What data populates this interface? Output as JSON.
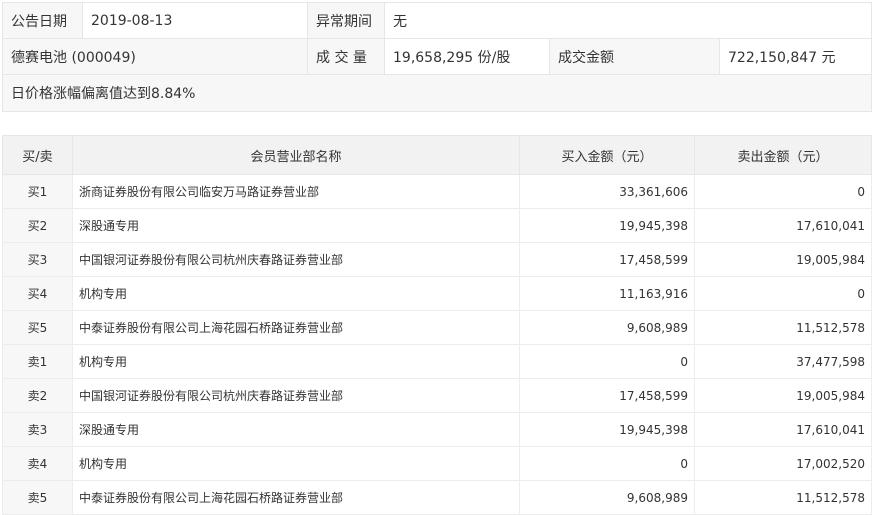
{
  "summary": {
    "date_label": "公告日期",
    "date_value": "2019-08-13",
    "period_label": "异常期间",
    "period_value": "无",
    "stock_label": "德赛电池 (000049)",
    "volume_label": "成 交 量",
    "volume_value": "19,658,295 份/股",
    "amount_label": "成交金额",
    "amount_value": "722,150,847 元",
    "reason": "日价格涨幅偏离值达到8.84%"
  },
  "table": {
    "headers": [
      "买/卖",
      "会员营业部名称",
      "买入金额（元）",
      "卖出金额（元）"
    ],
    "rows": [
      [
        "买1",
        "浙商证券股份有限公司临安万马路证券营业部",
        "33,361,606",
        "0"
      ],
      [
        "买2",
        "深股通专用",
        "19,945,398",
        "17,610,041"
      ],
      [
        "买3",
        "中国银河证券股份有限公司杭州庆春路证券营业部",
        "17,458,599",
        "19,005,984"
      ],
      [
        "买4",
        "机构专用",
        "11,163,916",
        "0"
      ],
      [
        "买5",
        "中泰证券股份有限公司上海花园石桥路证券营业部",
        "9,608,989",
        "11,512,578"
      ],
      [
        "卖1",
        "机构专用",
        "0",
        "37,477,598"
      ],
      [
        "卖2",
        "中国银河证券股份有限公司杭州庆春路证券营业部",
        "17,458,599",
        "19,005,984"
      ],
      [
        "卖3",
        "深股通专用",
        "19,945,398",
        "17,610,041"
      ],
      [
        "卖4",
        "机构专用",
        "0",
        "17,002,520"
      ],
      [
        "卖5",
        "中泰证券股份有限公司上海花园石桥路证券营业部",
        "9,608,989",
        "11,512,578"
      ]
    ]
  }
}
